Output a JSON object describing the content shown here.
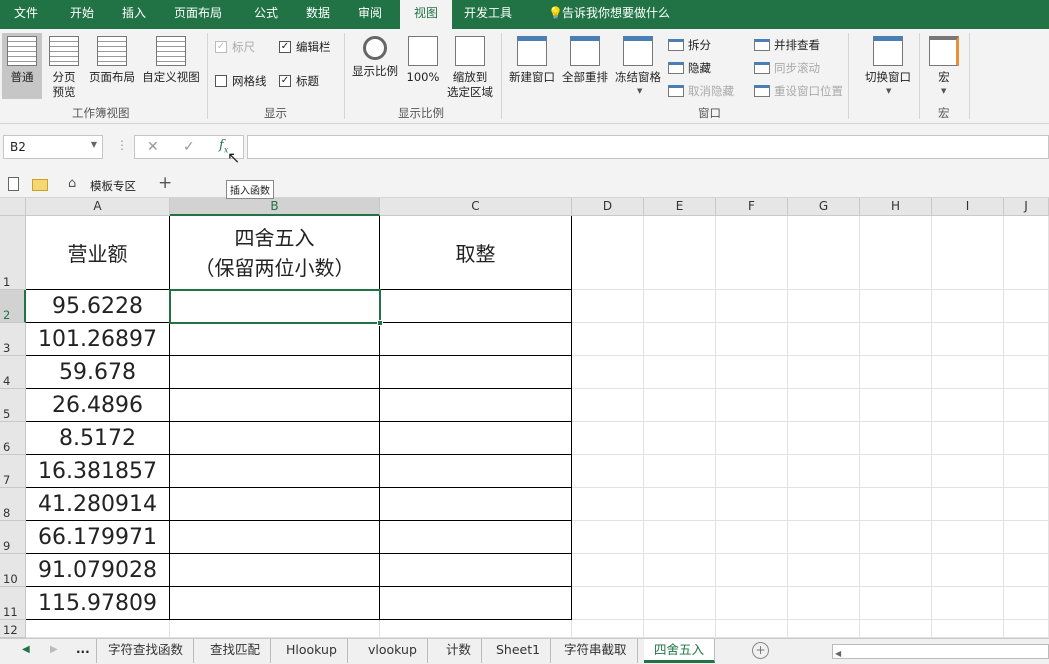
{
  "menu": {
    "tabs": [
      "文件",
      "开始",
      "插入",
      "页面布局",
      "公式",
      "数据",
      "审阅",
      "视图",
      "开发工具"
    ],
    "active": 7,
    "tell_me": "告诉我你想要做什么"
  },
  "ribbon": {
    "workbook_views": {
      "label": "工作簿视图",
      "buttons": [
        "普通",
        "分页\n预览",
        "页面布局",
        "自定义视图"
      ]
    },
    "show": {
      "label": "显示",
      "checks": [
        {
          "label": "标尺",
          "checked": true,
          "disabled": true
        },
        {
          "label": "编辑栏",
          "checked": true
        },
        {
          "label": "网格线",
          "checked": false
        },
        {
          "label": "标题",
          "checked": true
        }
      ]
    },
    "zoom": {
      "label": "显示比例",
      "buttons": [
        "显示比例",
        "100%",
        "缩放到\n选定区域"
      ]
    },
    "window": {
      "label": "窗口",
      "buttons": [
        "新建窗口",
        "全部重排",
        "冻结窗格"
      ],
      "small": [
        "拆分",
        "隐藏",
        "取消隐藏",
        "并排查看",
        "同步滚动",
        "重设窗口位置"
      ],
      "switch": "切换窗口"
    },
    "macro": {
      "label": "宏",
      "button": "宏"
    }
  },
  "formula_bar": {
    "name_box": "B2",
    "value": "",
    "tooltip": "插入函数"
  },
  "quick": {
    "template_label": "模板专区"
  },
  "grid": {
    "columns": [
      "A",
      "B",
      "C",
      "D",
      "E",
      "F",
      "G",
      "H",
      "I",
      "J"
    ],
    "rows": [
      "1",
      "2",
      "3",
      "4",
      "5",
      "6",
      "7",
      "8",
      "9",
      "10",
      "11",
      "12"
    ],
    "selected_cell": "B2",
    "headers": [
      "营业额",
      "四舍五入\n（保留两位小数）",
      "取整"
    ],
    "values": [
      "95.6228",
      "101.26897",
      "59.678",
      "26.4896",
      "8.5172",
      "16.381857",
      "41.280914",
      "66.179971",
      "91.079028",
      "115.97809"
    ]
  },
  "sheets": {
    "tabs": [
      "字符查找函数",
      "查找匹配",
      "Hlookup",
      "vlookup",
      "计数",
      "Sheet1",
      "字符串截取",
      "四舍五入"
    ],
    "active": 7,
    "more": "..."
  }
}
